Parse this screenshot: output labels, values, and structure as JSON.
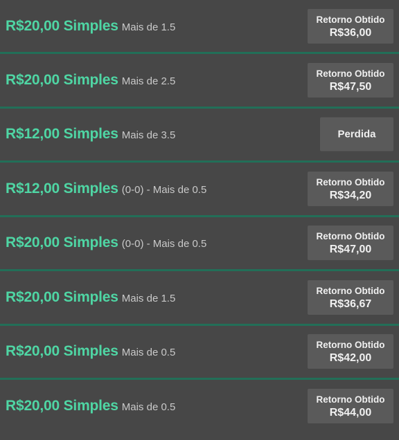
{
  "bets": [
    {
      "amount": "R$20,00 Simples",
      "market": "Mais de 1.5",
      "result_label": "Retorno Obtido",
      "result_value": "R$36,00",
      "status": "won"
    },
    {
      "amount": "R$20,00 Simples",
      "market": "Mais de 2.5",
      "result_label": "Retorno Obtido",
      "result_value": "R$47,50",
      "status": "won"
    },
    {
      "amount": "R$12,00 Simples",
      "market": "Mais de 3.5",
      "result_label": "",
      "result_value": "Perdida",
      "status": "lost"
    },
    {
      "amount": "R$12,00 Simples",
      "market": "(0-0) - Mais de 0.5",
      "result_label": "Retorno Obtido",
      "result_value": "R$34,20",
      "status": "won"
    },
    {
      "amount": "R$20,00 Simples",
      "market": "(0-0) - Mais de 0.5",
      "result_label": "Retorno Obtido",
      "result_value": "R$47,00",
      "status": "won"
    },
    {
      "amount": "R$20,00 Simples",
      "market": "Mais de 1.5",
      "result_label": "Retorno Obtido",
      "result_value": "R$36,67",
      "status": "won"
    },
    {
      "amount": "R$20,00 Simples",
      "market": "Mais de 0.5",
      "result_label": "Retorno Obtido",
      "result_value": "R$42,00",
      "status": "won"
    },
    {
      "amount": "R$20,00 Simples",
      "market": "Mais de 0.5",
      "result_label": "Retorno Obtido",
      "result_value": "R$44,00",
      "status": "won"
    }
  ],
  "colors": {
    "background": "#474747",
    "separator": "#226f58",
    "stake_green": "#4fd6a4",
    "result_box": "#5a5a5a"
  }
}
